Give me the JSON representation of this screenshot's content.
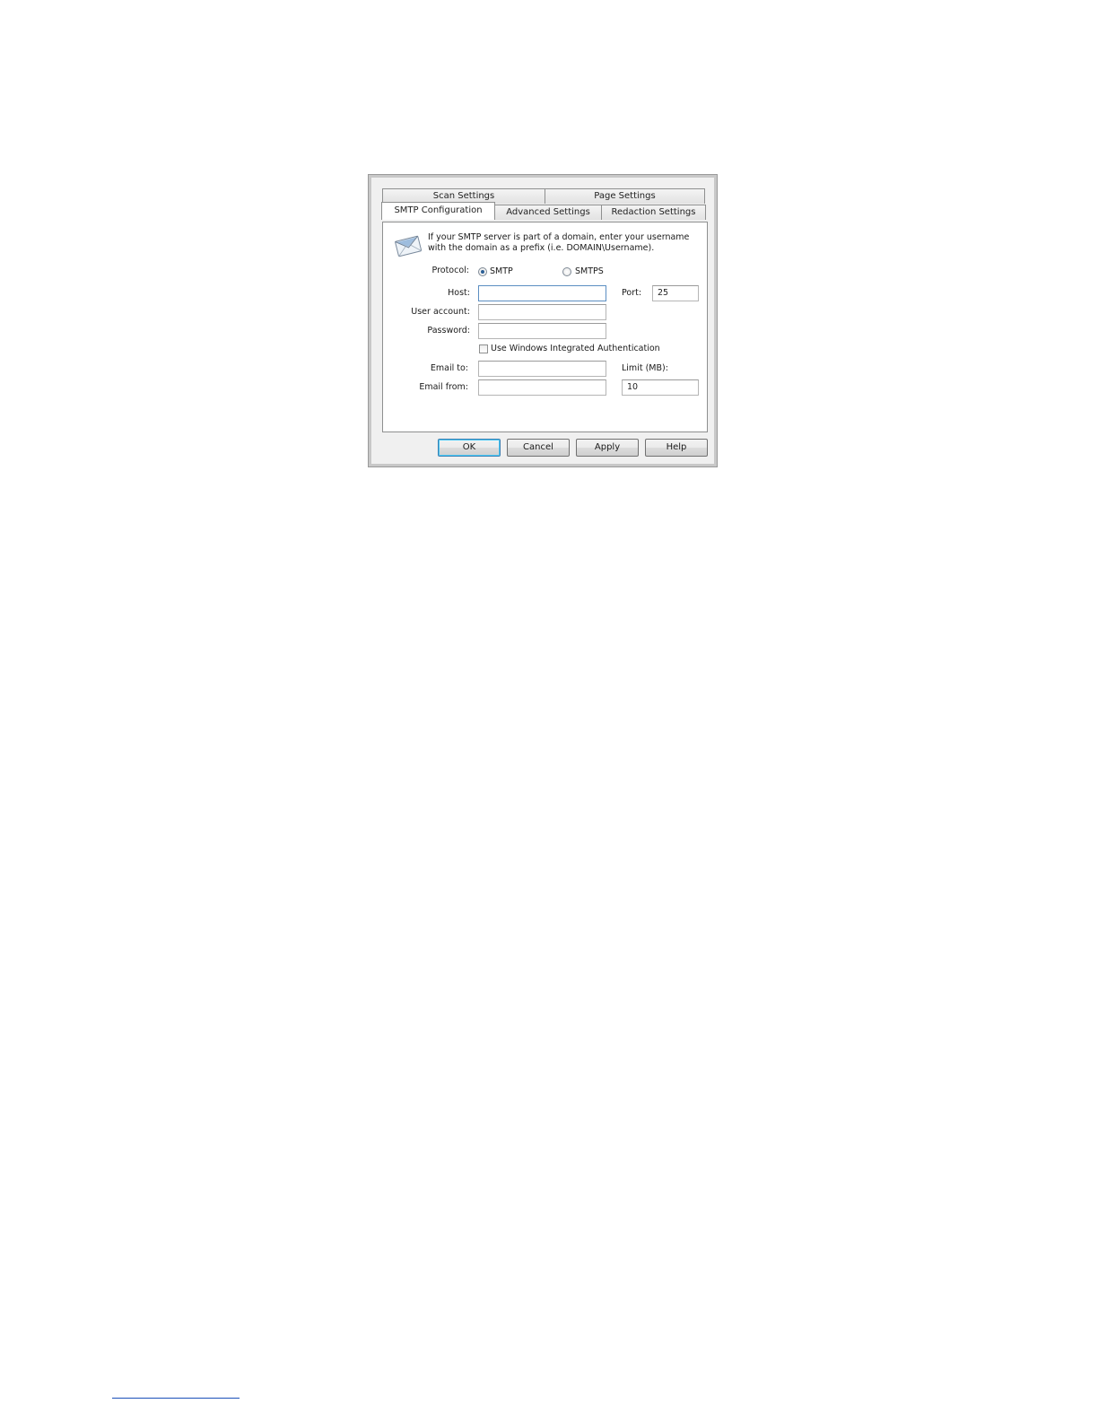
{
  "tabs": {
    "row1": [
      "Scan Settings",
      "Page Settings"
    ],
    "row2": [
      "SMTP Configuration",
      "Advanced Settings",
      "Redaction Settings"
    ]
  },
  "info_text": {
    "line1": "If your SMTP server is part of a domain, enter your username",
    "line2": "with the domain as a prefix (i.e. DOMAIN\\Username)."
  },
  "protocol": {
    "label": "Protocol:",
    "options": [
      "SMTP",
      "SMTPS"
    ],
    "selected": "SMTP"
  },
  "fields": {
    "host_label": "Host:",
    "host_value": "",
    "port_label": "Port:",
    "port_value": "25",
    "user_label": "User account:",
    "user_value": "",
    "password_label": "Password:",
    "password_value": "",
    "windows_auth_label": "Use Windows Integrated Authentication",
    "windows_auth_checked": false,
    "email_to_label": "Email to:",
    "email_to_value": "",
    "limit_label": "Limit (MB):",
    "limit_value": "10",
    "email_from_label": "Email from:",
    "email_from_value": ""
  },
  "buttons": {
    "ok": "OK",
    "cancel": "Cancel",
    "apply": "Apply",
    "help": "Help"
  },
  "colors": {
    "dialog_bg": "#f0f0f0",
    "focus_border": "#5b8ec2",
    "default_button_border": "#3c7fb1"
  },
  "icons": {
    "info": "envelope-icon"
  }
}
